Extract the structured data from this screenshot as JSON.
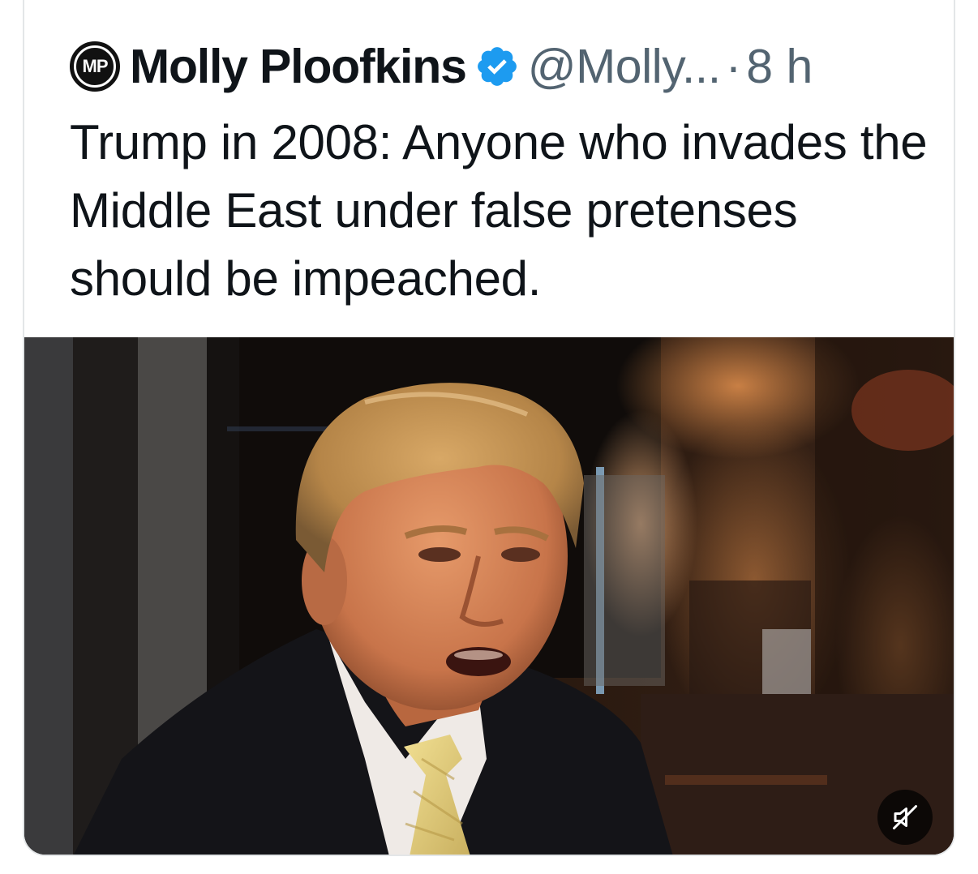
{
  "tweet": {
    "avatar_initials": "MP",
    "author_name": "Molly Ploofkins",
    "verified": true,
    "handle": "@Molly...",
    "separator": "·",
    "time": "8 h",
    "text": "Trump in 2008: Anyone who invades the Middle East under false pretenses should be impeached."
  },
  "media": {
    "type": "video",
    "muted": true,
    "icons": {
      "mute": "speaker-muted-icon",
      "verified": "verified-badge-icon"
    }
  },
  "colors": {
    "text": "#0f1419",
    "secondary": "#536471",
    "verified_blue": "#1d9bf0",
    "border": "#e3e6e8"
  }
}
